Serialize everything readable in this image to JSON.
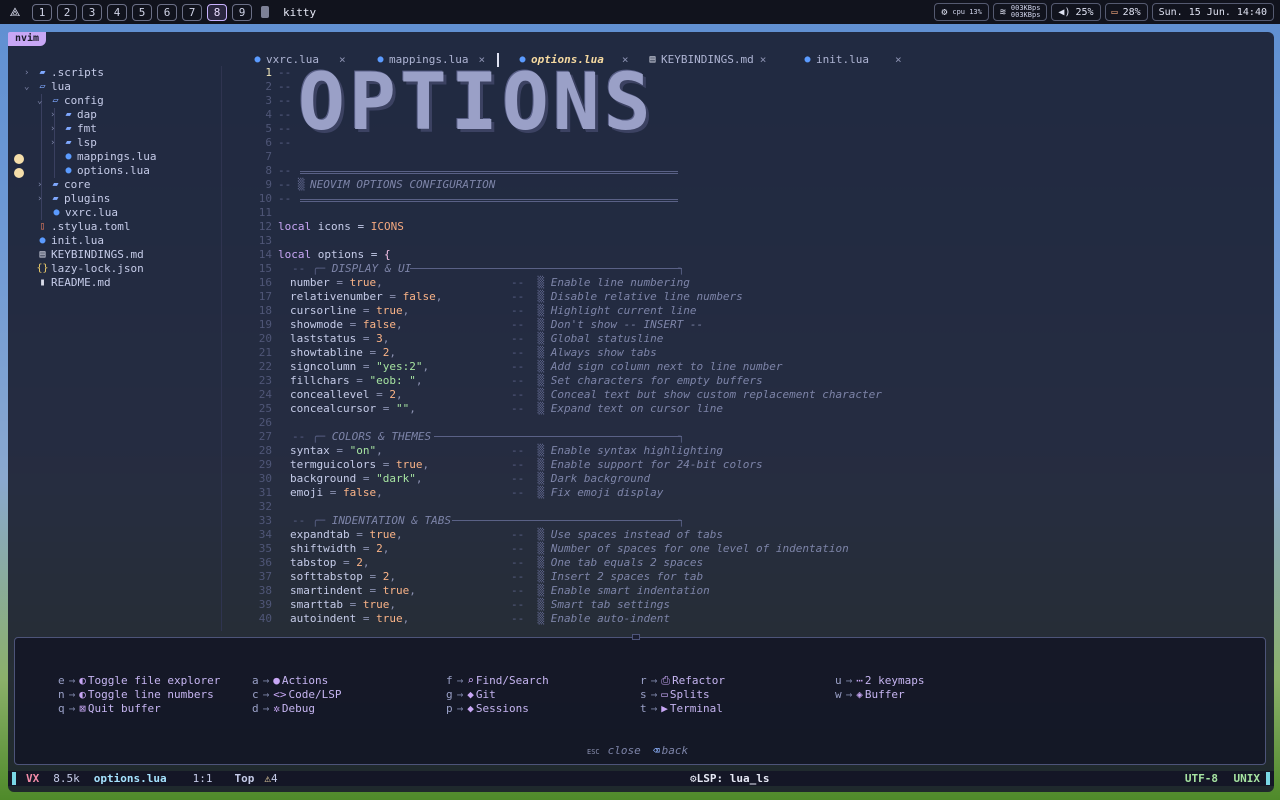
{
  "topbar": {
    "workspaces": [
      "1",
      "2",
      "3",
      "4",
      "5",
      "6",
      "7",
      "8",
      "9"
    ],
    "active_workspace": "8",
    "window_title": "kitty",
    "cpu": "cpu 13%",
    "net_up": "003KBps",
    "net_down": "003KBps",
    "volume": "25%",
    "battery": "28%",
    "datetime": "Sun. 15 Jun. 14:40"
  },
  "app_tag": "nvim",
  "tabs": [
    {
      "label": "vxrc.lua",
      "close": "×"
    },
    {
      "label": "mappings.lua",
      "close": "×"
    },
    {
      "label": "options.lua",
      "close": "×"
    },
    {
      "label": "KEYBINDINGS.md",
      "close": "×"
    },
    {
      "label": "init.lua",
      "close": "×"
    }
  ],
  "tree": [
    {
      "label": ".scripts"
    },
    {
      "label": "lua"
    },
    {
      "label": "config"
    },
    {
      "label": "dap"
    },
    {
      "label": "fmt"
    },
    {
      "label": "lsp"
    },
    {
      "label": "mappings.lua"
    },
    {
      "label": "options.lua"
    },
    {
      "label": "core"
    },
    {
      "label": "plugins"
    },
    {
      "label": "vxrc.lua"
    },
    {
      "label": ".stylua.toml"
    },
    {
      "label": "init.lua"
    },
    {
      "label": "KEYBINDINGS.md"
    },
    {
      "label": "lazy-lock.json"
    },
    {
      "label": "README.md"
    }
  ],
  "editor": {
    "big_title": "OPTIONS",
    "line_numbers": [
      "1",
      "2",
      "3",
      "4",
      "5",
      "6",
      "7",
      "8",
      "9",
      "10",
      "11",
      "12",
      "13",
      "14",
      "15",
      "16",
      "17",
      "18",
      "19",
      "20",
      "21",
      "22",
      "23",
      "24",
      "25",
      "26",
      "27",
      "28",
      "29",
      "30",
      "31",
      "32",
      "33",
      "34",
      "35",
      "36",
      "37",
      "38",
      "39",
      "40"
    ],
    "header_comment": "NEOVIM OPTIONS CONFIGURATION",
    "icons_line": {
      "kw": "local",
      "name": " icons = ",
      "val": "ICONS"
    },
    "options_line": {
      "kw": "local",
      "name": " options = ",
      "brace": "{"
    },
    "sections": [
      {
        "title": "DISPLAY & UI"
      },
      {
        "title": "COLORS & THEMES"
      },
      {
        "title": "INDENTATION & TABS"
      }
    ],
    "opts": [
      {
        "key": "number",
        "val": "true",
        "type": "bool",
        "comment": "Enable line numbering"
      },
      {
        "key": "relativenumber",
        "val": "false",
        "type": "bool",
        "comment": "Disable relative line numbers"
      },
      {
        "key": "cursorline",
        "val": "true",
        "type": "bool",
        "comment": "Highlight current line"
      },
      {
        "key": "showmode",
        "val": "false",
        "type": "bool",
        "comment": "Don't show -- INSERT --"
      },
      {
        "key": "laststatus",
        "val": "3",
        "type": "num",
        "comment": "Global statusline"
      },
      {
        "key": "showtabline",
        "val": "2",
        "type": "num",
        "comment": "Always show tabs"
      },
      {
        "key": "signcolumn",
        "val": "\"yes:2\"",
        "type": "str",
        "comment": "Add sign column next to line number"
      },
      {
        "key": "fillchars",
        "val": "\"eob: \"",
        "type": "str",
        "comment": "Set characters for empty buffers"
      },
      {
        "key": "conceallevel",
        "val": "2",
        "type": "num",
        "comment": "Conceal text but show custom replacement character"
      },
      {
        "key": "concealcursor",
        "val": "\"\"",
        "type": "str",
        "comment": "Expand text on cursor line"
      },
      {
        "key": "syntax",
        "val": "\"on\"",
        "type": "str",
        "comment": "Enable syntax highlighting"
      },
      {
        "key": "termguicolors",
        "val": "true",
        "type": "bool",
        "comment": "Enable support for 24-bit colors"
      },
      {
        "key": "background",
        "val": "\"dark\"",
        "type": "str",
        "comment": "Dark background"
      },
      {
        "key": "emoji",
        "val": "false",
        "type": "bool",
        "comment": "Fix emoji display"
      },
      {
        "key": "expandtab",
        "val": "true",
        "type": "bool",
        "comment": "Use spaces instead of tabs"
      },
      {
        "key": "shiftwidth",
        "val": "2",
        "type": "num",
        "comment": "Number of spaces for one level of indentation"
      },
      {
        "key": "tabstop",
        "val": "2",
        "type": "num",
        "comment": "One tab equals 2 spaces"
      },
      {
        "key": "softtabstop",
        "val": "2",
        "type": "num",
        "comment": "Insert 2 spaces for tab"
      },
      {
        "key": "smartindent",
        "val": "true",
        "type": "bool",
        "comment": "Enable smart indentation"
      },
      {
        "key": "smarttab",
        "val": "true",
        "type": "bool",
        "comment": "Smart tab settings"
      },
      {
        "key": "autoindent",
        "val": "true",
        "type": "bool",
        "comment": "Enable auto-indent"
      }
    ]
  },
  "whichkey": {
    "items": [
      {
        "key": "e",
        "label": "Toggle file explorer"
      },
      {
        "key": "n",
        "label": "Toggle line numbers"
      },
      {
        "key": "q",
        "label": "Quit buffer"
      },
      {
        "key": "a",
        "label": "Actions"
      },
      {
        "key": "c",
        "label": "Code/LSP"
      },
      {
        "key": "d",
        "label": "Debug"
      },
      {
        "key": "f",
        "label": "Find/Search"
      },
      {
        "key": "g",
        "label": "Git"
      },
      {
        "key": "p",
        "label": "Sessions"
      },
      {
        "key": "r",
        "label": "Refactor"
      },
      {
        "key": "s",
        "label": "Splits"
      },
      {
        "key": "t",
        "label": "Terminal"
      },
      {
        "key": "u",
        "label": "2 keymaps"
      },
      {
        "key": "w",
        "label": "Buffer"
      }
    ],
    "arrow": "→",
    "esc_key": "ESC",
    "close_label": "close",
    "back_label": "back"
  },
  "statusline": {
    "mode": "VX",
    "size": "8.5k",
    "filename": "options.lua",
    "position": "1:1",
    "scroll": "Top",
    "warnings": "4",
    "lsp": "LSP: lua_ls",
    "encoding": "UTF-8",
    "fileformat": "UNIX"
  },
  "colors": {
    "accent": "#c8a7f5",
    "active_tab": "#f5d9a0",
    "string": "#a6e3a1",
    "number": "#fab387"
  }
}
